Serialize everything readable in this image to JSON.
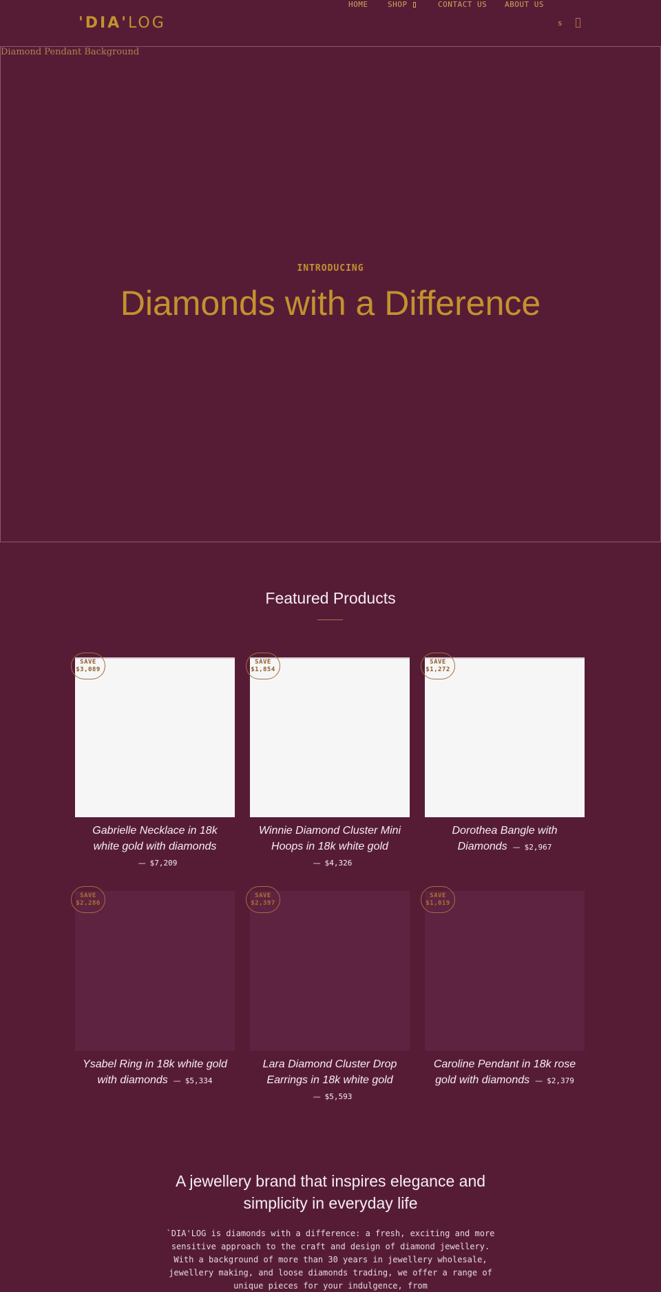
{
  "header": {
    "logo_bold": "'DIA'",
    "logo_light": "LOG",
    "nav": [
      {
        "label": "HOME"
      },
      {
        "label": "SHOP"
      },
      {
        "label": "CONTACT US"
      },
      {
        "label": "ABOUT US"
      }
    ],
    "search_glyph": "s",
    "icons": [
      "search-icon",
      "cart-icon",
      "chevron-down-icon"
    ]
  },
  "hero": {
    "image_alt": "Diamond Pendant Background",
    "kicker": "INTRODUCING",
    "title": "Diamonds with a Difference"
  },
  "featured": {
    "title": "Featured Products",
    "products": [
      {
        "name": "Gabrielle Necklace in 18k white gold with diamonds",
        "price": "$7,209",
        "save_label": "SAVE",
        "save": "$3,089",
        "image_loaded": true
      },
      {
        "name": "Winnie Diamond Cluster Mini Hoops in 18k white gold",
        "price": "$4,326",
        "save_label": "SAVE",
        "save": "$1,854",
        "image_loaded": true
      },
      {
        "name": "Dorothea Bangle with Diamonds",
        "price": "$2,967",
        "save_label": "SAVE",
        "save": "$1,272",
        "image_loaded": true
      },
      {
        "name": "Ysabel Ring in 18k white gold with diamonds",
        "price": "$5,334",
        "save_label": "SAVE",
        "save": "$2,286",
        "image_loaded": false
      },
      {
        "name": "Lara Diamond Cluster Drop Earrings in 18k white gold",
        "price": "$5,593",
        "save_label": "SAVE",
        "save": "$2,397",
        "image_loaded": false
      },
      {
        "name": "Caroline Pendant in 18k rose gold with diamonds",
        "price": "$2,379",
        "save_label": "SAVE",
        "save": "$1,019",
        "image_loaded": false
      }
    ],
    "separator": "—"
  },
  "about": {
    "title": "A jewellery brand that inspires elegance and simplicity in everyday life",
    "text": "`DIA'LOG is diamonds with a difference: a fresh, exciting and more sensitive approach to the craft and design of diamond jewellery. With a background of more than 30 years in jewellery wholesale, jewellery making, and loose diamonds trading, we offer a range of unique pieces for your indulgence, from"
  },
  "colors": {
    "background": "#561c36",
    "gold": "#c3922e",
    "nav_text": "#d3a257",
    "text_light": "#f6eef2"
  }
}
